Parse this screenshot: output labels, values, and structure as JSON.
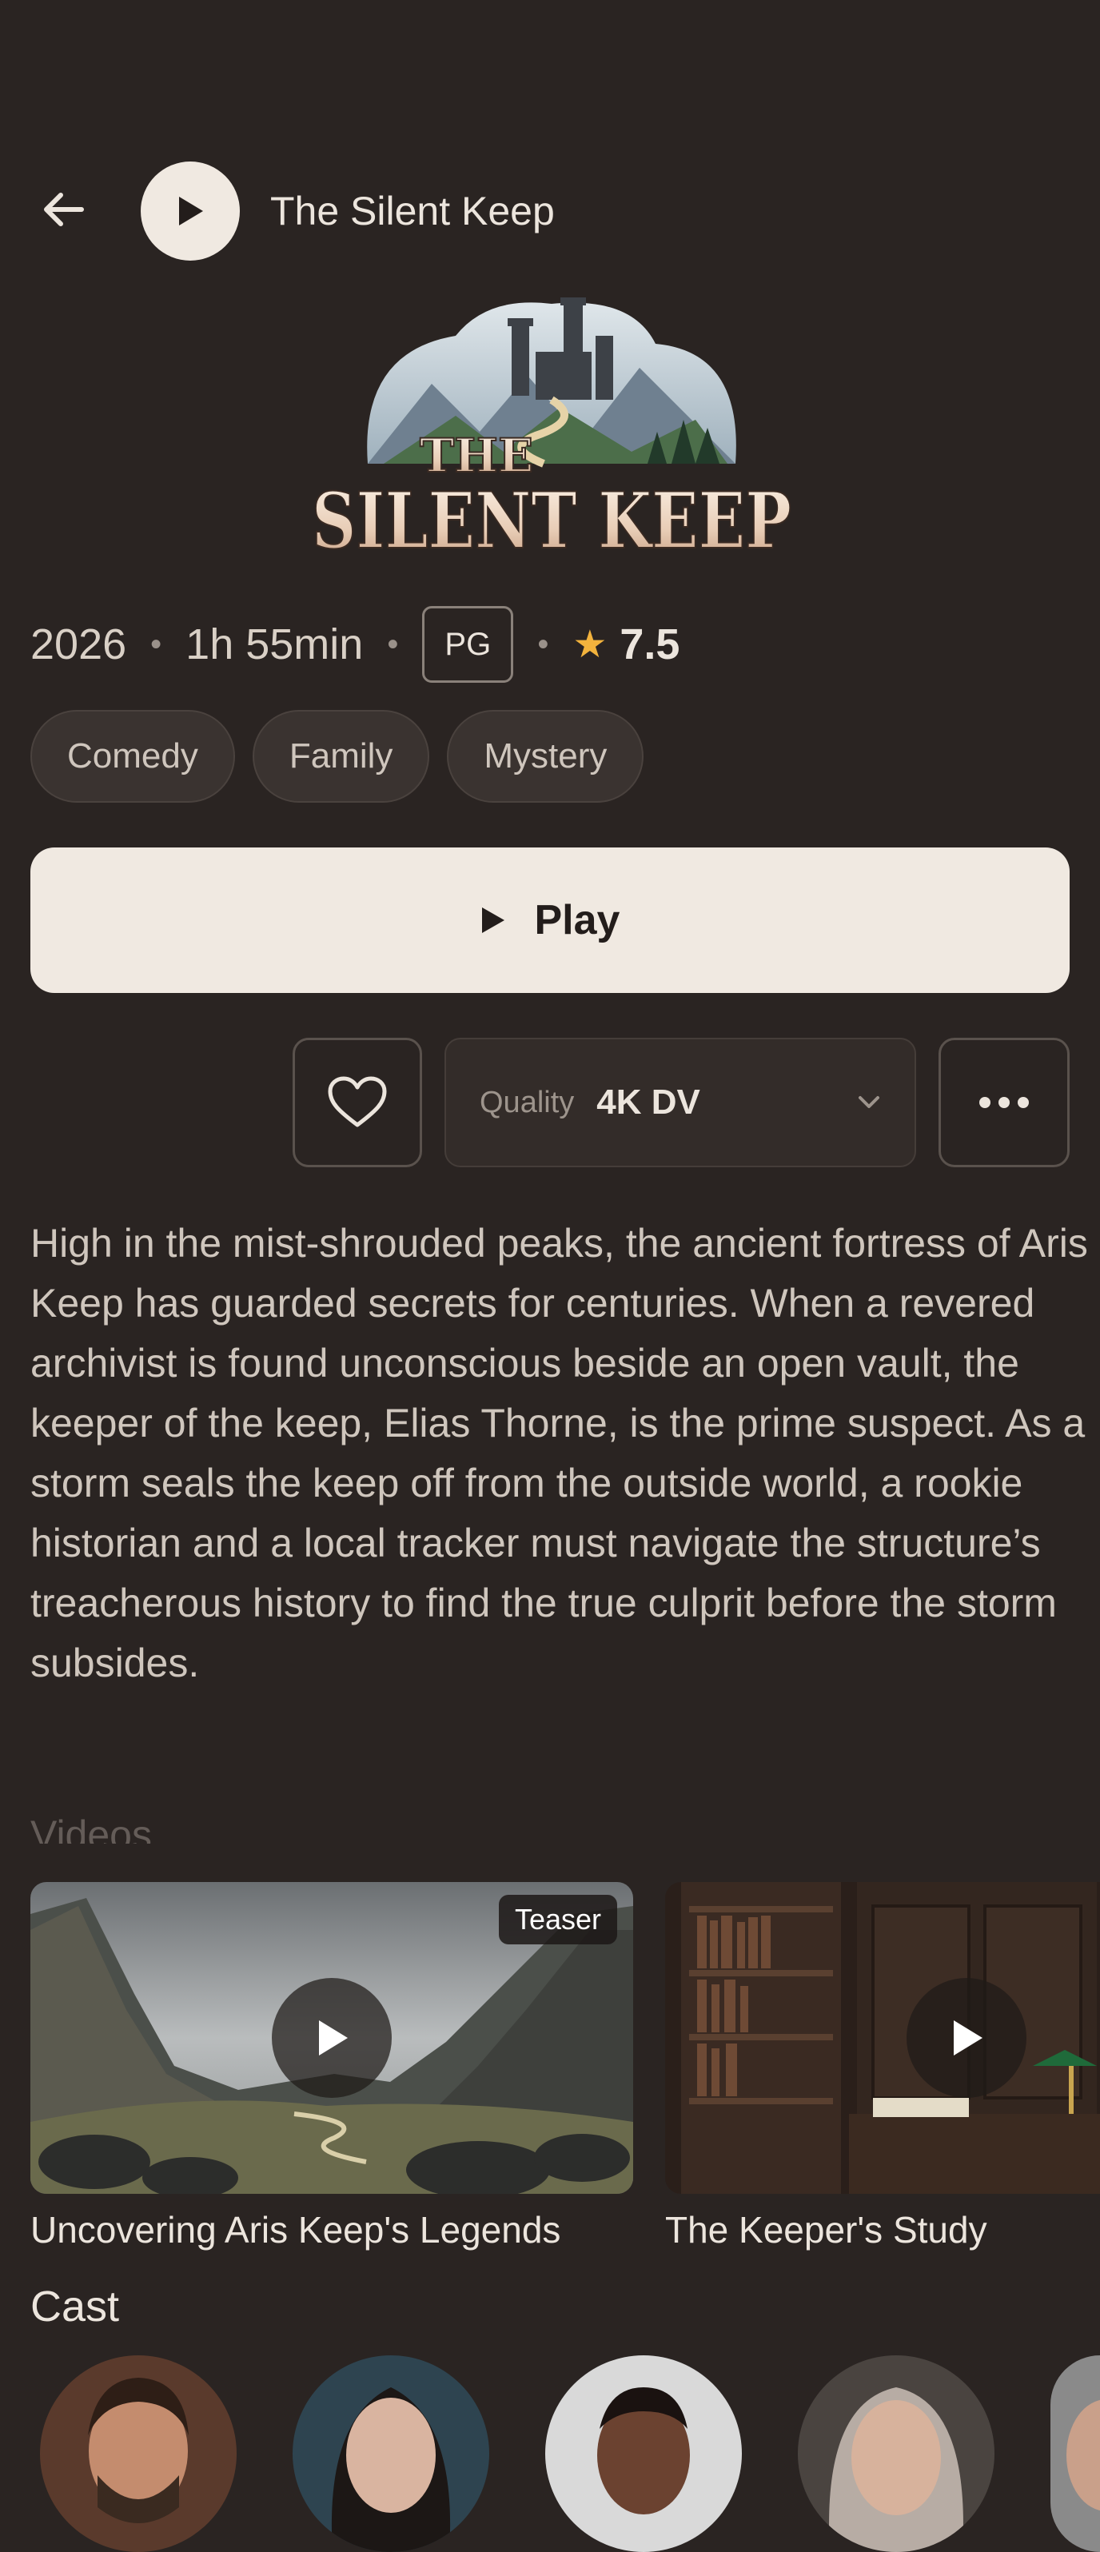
{
  "header": {
    "title": "The Silent Keep"
  },
  "logo": {
    "line1": "THE",
    "line2": "SILENT KEEP"
  },
  "meta": {
    "year": "2026",
    "duration": "1h 55min",
    "rating": "PG",
    "score": "7.5"
  },
  "genres": [
    "Comedy",
    "Family",
    "Mystery"
  ],
  "play_button": {
    "label": "Play"
  },
  "quality": {
    "label": "Quality",
    "value": "4K DV"
  },
  "description": "High in the mist-shrouded peaks, the ancient fortress of Aris Keep has guarded secrets for centuries. When a revered archivist is found unconscious beside an open vault, the keeper of the keep, Elias Thorne, is the prime suspect. As a storm seals the keep off from the outside world, a rookie historian and a local tracker must navigate the structure’s treacherous history to find the true culprit before the storm subsides.",
  "videos": {
    "heading": "Videos",
    "items": [
      {
        "title": "Uncovering Aris Keep's Legends",
        "badge": "Teaser"
      },
      {
        "title": "The Keeper's Study"
      }
    ]
  },
  "cast": {
    "heading": "Cast"
  },
  "colors": {
    "background": "#2a2422",
    "accent": "#f0e9e1",
    "star": "#f3b33d"
  },
  "icons": {
    "back": "arrow-left-icon",
    "play": "play-icon",
    "favorite": "heart-icon",
    "dropdown": "chevron-down-icon",
    "more": "more-horizontal-icon",
    "star": "star-icon"
  }
}
